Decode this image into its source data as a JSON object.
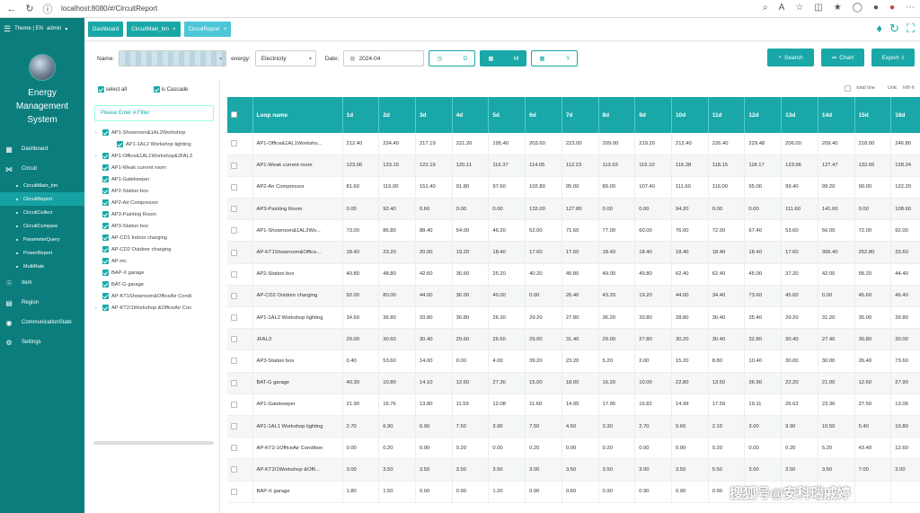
{
  "browser": {
    "url": "localhost:8080/#/CircuitReport"
  },
  "sidebar": {
    "theme_label": "Theme | EN",
    "user": "admin",
    "app_name_lines": [
      "Energy",
      "Management",
      "System"
    ],
    "items": [
      {
        "label": "Dashboard",
        "icon": "dashboard-icon"
      },
      {
        "label": "Circuit",
        "icon": "circuit-icon"
      }
    ],
    "circuit_sub": [
      "CircuitMain_bm",
      "CircuitReport",
      "CircuitCollect",
      "CircuitCompare",
      "ParameterQuery",
      "PowerReport",
      "MultiRate"
    ],
    "active_sub": "CircuitReport",
    "items_after": [
      {
        "label": "Item",
        "icon": "item-icon"
      },
      {
        "label": "Region",
        "icon": "region-icon"
      },
      {
        "label": "CommunicationState",
        "icon": "location-icon"
      },
      {
        "label": "Settings",
        "icon": "gear-icon"
      }
    ]
  },
  "tabs": [
    {
      "label": "Dashboard",
      "closable": false
    },
    {
      "label": "CircuitMain_bm",
      "closable": true
    },
    {
      "label": "CircuitReport",
      "closable": true,
      "active": true
    }
  ],
  "filters": {
    "name_label": "Name:",
    "energy_label": "energy:",
    "energy_value": "Electricity",
    "date_label": "Date:",
    "date_value": "2024-04",
    "btn_day": "D",
    "btn_month": "M",
    "btn_year": "Y",
    "search": "Search",
    "chart": "Chart",
    "export": "Export"
  },
  "panel": {
    "select_all": "select all",
    "cascade": "is Cascade",
    "filter_placeholder": "Please Enter A Filter",
    "tree": [
      {
        "label": "AP1-Showroom&1AL2Workshop",
        "level": 0,
        "expand": true
      },
      {
        "label": "AP1-1AL2 Workshop lighting",
        "level": 1
      },
      {
        "label": "AP1-Office&1AL1Workshop&JFAL3",
        "level": 0,
        "expand": true
      },
      {
        "label": "AP1-Weak current room",
        "level": 0
      },
      {
        "label": "AP1-Gatekeeper",
        "level": 0
      },
      {
        "label": "AP2-Station box",
        "level": 0
      },
      {
        "label": "AP2-Air Compressor",
        "level": 0
      },
      {
        "label": "AP3-Painting Room",
        "level": 0
      },
      {
        "label": "AP3-Station box",
        "level": 0
      },
      {
        "label": "AP-CD1 Indoor charging",
        "level": 0
      },
      {
        "label": "AP-CD2 Outdoor charging",
        "level": 0
      },
      {
        "label": "AP-mc",
        "level": 0
      },
      {
        "label": "BAP-X garage",
        "level": 0
      },
      {
        "label": "BAT-G garage",
        "level": 0
      },
      {
        "label": "AP-KT1Showroom&OfficeAir Condi",
        "level": 0,
        "expand": true
      },
      {
        "label": "AP-KT2/1Workshop &OfficeAir Con",
        "level": 0,
        "expand": true
      }
    ]
  },
  "table": {
    "total_line": "total line",
    "unit_label": "Unit:",
    "unit": "kW·h",
    "headers": [
      "Loop name",
      "1d",
      "2d",
      "3d",
      "4d",
      "5d",
      "6d",
      "7d",
      "8d",
      "9d",
      "10d",
      "11d",
      "12d",
      "13d",
      "14d",
      "15d",
      "16d"
    ],
    "rows": [
      [
        "AP1-Office&1AL1Worksho...",
        "212.40",
        "224.40",
        "217.19",
        "221.20",
        "195.40",
        "203.60",
        "223.00",
        "209.00",
        "219.20",
        "212.40",
        "226.40",
        "229.48",
        "206.00",
        "209.40",
        "218.00",
        "246.80"
      ],
      [
        "AP1-Weak current room",
        "123.06",
        "123.15",
        "122.19",
        "120.11",
        "116.37",
        "114.05",
        "112.23",
        "113.93",
        "116.10",
        "116.28",
        "118.15",
        "118.17",
        "123.96",
        "127.47",
        "132.65",
        "128.24"
      ],
      [
        "AP2-Air Compressor",
        "81.60",
        "116.00",
        "151.40",
        "91.80",
        "97.60",
        "102.80",
        "95.00",
        "89.00",
        "107.40",
        "111.60",
        "116.00",
        "95.00",
        "99.40",
        "99.20",
        "90.00",
        "122.20"
      ],
      [
        "AP3-Painting Room",
        "0.00",
        "92.40",
        "0.60",
        "0.00",
        "0.00",
        "132.00",
        "127.80",
        "0.00",
        "0.00",
        "94.20",
        "0.00",
        "0.00",
        "111.60",
        "141.00",
        "0.00",
        "108.60"
      ],
      [
        "AP1-Showroom&1AL2Wo...",
        "73.00",
        "86.80",
        "88.40",
        "54.00",
        "46.20",
        "52.00",
        "71.60",
        "77.00",
        "60.00",
        "76.00",
        "72.00",
        "67.40",
        "53.60",
        "56.00",
        "72.00",
        "92.00"
      ],
      [
        "AP-KT1Showroom&Office...",
        "18.40",
        "23.20",
        "20.00",
        "19.20",
        "18.40",
        "17.60",
        "17.60",
        "18.40",
        "18.40",
        "18.40",
        "18.40",
        "18.40",
        "17.60",
        "306.40",
        "252.80",
        "33.60"
      ],
      [
        "AP2-Station box",
        "40.80",
        "48.80",
        "42.60",
        "36.60",
        "25.20",
        "40.20",
        "40.80",
        "49.00",
        "49.80",
        "62.40",
        "62.40",
        "45.00",
        "37.20",
        "42.00",
        "58.20",
        "44.40"
      ],
      [
        "AP-CD2 Outdoor charging",
        "92.00",
        "80.00",
        "44.00",
        "36.00",
        "40.00",
        "0.00",
        "26.40",
        "43.20",
        "19.20",
        "44.00",
        "34.40",
        "73.60",
        "45.60",
        "0.00",
        "45.60",
        "46.40"
      ],
      [
        "AP1-1AL2 Workshop lighting",
        "34.60",
        "36.80",
        "33.80",
        "36.80",
        "26.20",
        "29.20",
        "27.80",
        "36.20",
        "33.80",
        "28.80",
        "30.40",
        "35.40",
        "29.20",
        "31.20",
        "35.00",
        "39.80"
      ],
      [
        "JFAL3",
        "29.00",
        "30.60",
        "30.40",
        "29.60",
        "26.60",
        "29.00",
        "31.40",
        "29.00",
        "27.80",
        "30.20",
        "30.40",
        "32.80",
        "30.40",
        "27.40",
        "30.80",
        "30.00"
      ],
      [
        "AP3-Station box",
        "0.40",
        "53.60",
        "14.00",
        "0.00",
        "4.00",
        "39.20",
        "23.20",
        "5.20",
        "2.00",
        "15.20",
        "8.80",
        "10.40",
        "30.00",
        "30.00",
        "26.40",
        "73.60"
      ],
      [
        "BAT-G garage",
        "40.30",
        "10.80",
        "14.10",
        "12.60",
        "27.30",
        "15.00",
        "18.00",
        "16.20",
        "10.00",
        "22.80",
        "13.50",
        "36.90",
        "22.20",
        "21.00",
        "12.60",
        "27.90"
      ],
      [
        "AP1-Gatekeeper",
        "21.90",
        "16.76",
        "13.80",
        "11.59",
        "12.08",
        "11.60",
        "14.95",
        "17.95",
        "16.82",
        "14.99",
        "17.59",
        "19.11",
        "26.63",
        "23.36",
        "27.50",
        "13.06"
      ],
      [
        "AP1-1AL1 Workshop lighting",
        "2.70",
        "6.90",
        "6.90",
        "7.50",
        "3.90",
        "7.50",
        "4.50",
        "3.30",
        "2.70",
        "9.60",
        "2.10",
        "3.00",
        "9.90",
        "10.50",
        "5.40",
        "10.80"
      ],
      [
        "AP-KT2-1OfficeAir Condition",
        "0.00",
        "0.20",
        "0.00",
        "0.20",
        "0.00",
        "0.20",
        "0.00",
        "0.20",
        "0.00",
        "0.00",
        "0.20",
        "0.00",
        "0.20",
        "5.20",
        "43.40",
        "12.60"
      ],
      [
        "AP-KT2/1Workshop &Offi...",
        "3.00",
        "3.50",
        "3.50",
        "3.50",
        "3.50",
        "3.00",
        "3.50",
        "3.50",
        "3.00",
        "3.50",
        "5.50",
        "3.00",
        "3.50",
        "3.50",
        "7.00",
        "3.00"
      ],
      [
        "BAP-X garage",
        "1.80",
        "1.50",
        "0.00",
        "0.90",
        "1.20",
        "0.90",
        "0.60",
        "0.90",
        "0.90",
        "0.90",
        "0.90",
        "",
        "",
        "",
        "",
        ""
      ]
    ]
  },
  "watermark": "搜狐号@安科瑞戚婷",
  "colors": {
    "accent": "#1aa7a7",
    "sidebar": "#0b7d7d"
  }
}
